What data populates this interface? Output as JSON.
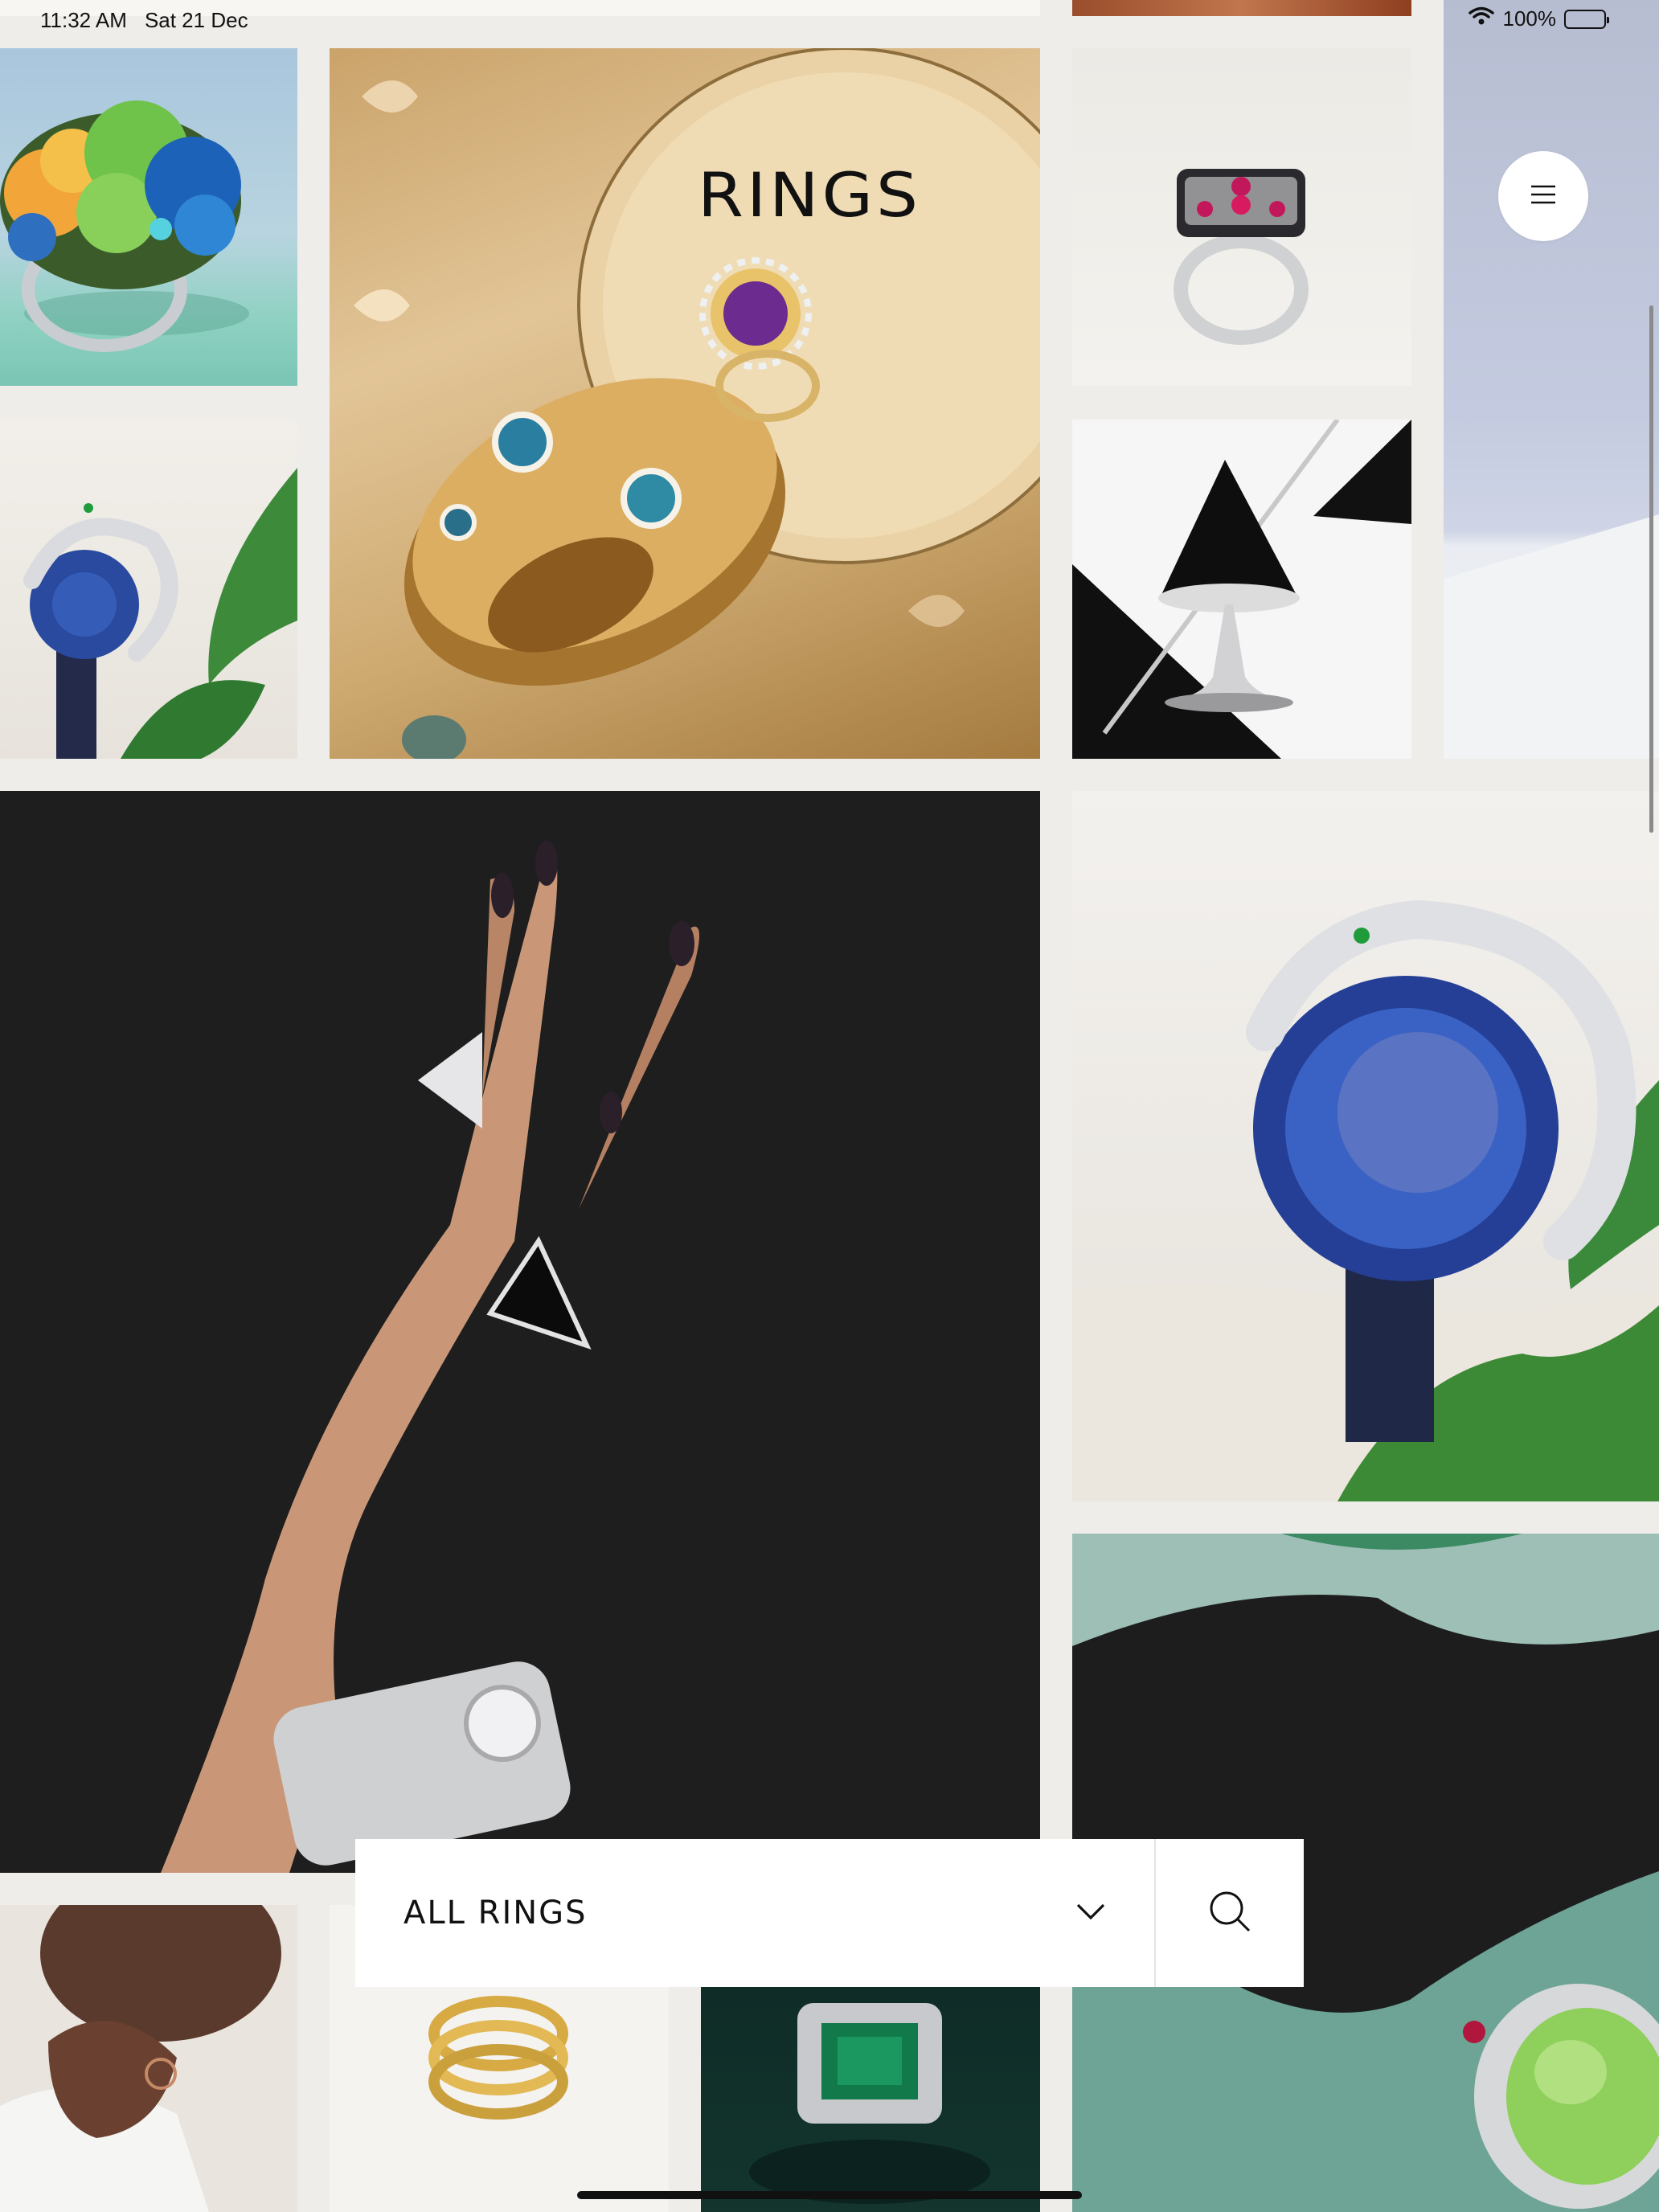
{
  "status_bar": {
    "time": "11:32 AM",
    "date": "Sat 21 Dec",
    "battery": "100%",
    "battery_level": 1.0
  },
  "hero": {
    "title": "RINGS"
  },
  "filter": {
    "selected": "ALL RINGS",
    "dropdown_icon": "chevron-down-icon",
    "search_icon": "search-icon"
  },
  "menu": {
    "icon": "hamburger-icon"
  },
  "colors": {
    "background": "#efede9",
    "text": "#111111",
    "panel": "#ffffff"
  }
}
